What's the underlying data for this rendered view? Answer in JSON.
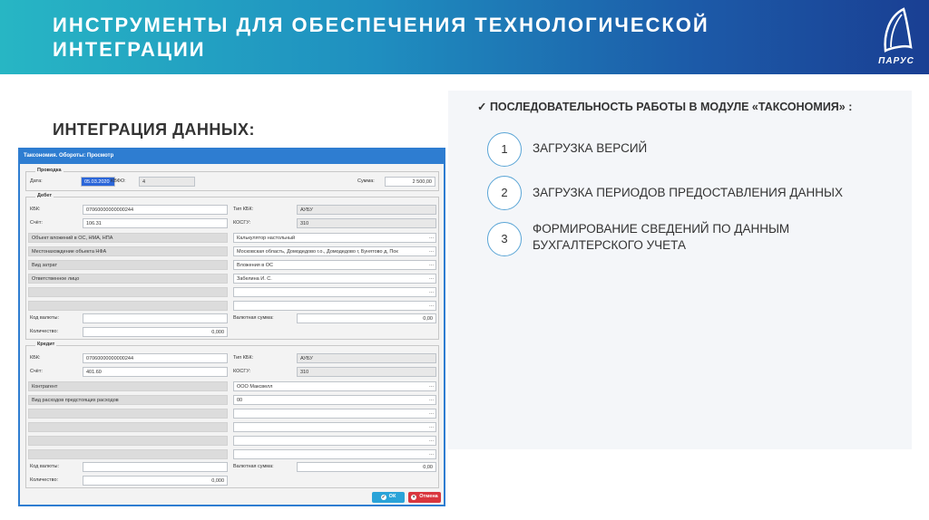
{
  "header": {
    "title_line1": "ИНСТРУМЕНТЫ ДЛЯ ОБЕСПЕЧЕНИЯ ТЕХНОЛОГИЧЕСКОЙ",
    "title_line2": "ИНТЕГРАЦИИ",
    "logo_text": "ПАРУС"
  },
  "section_title": "ИНТЕГРАЦИЯ ДАННЫХ:",
  "dialog": {
    "title": "Таксономия. Обороты: Просмотр",
    "posting": {
      "label": "Проводка",
      "date_label": "Дата:",
      "date_value": "05.03.2020",
      "kvfo_label": "КВФО:",
      "kvfo_value": "4",
      "sum_label": "Сумма:",
      "sum_value": "2 500,00"
    },
    "debit": {
      "label": "Дебет",
      "kbk_label": "КБК:",
      "kbk_value": "07060000000000244",
      "kbk_type_label": "Тип КБК:",
      "kbk_type_value": "АУБУ",
      "account_label": "Счёт:",
      "account_value": "106.31",
      "kosgu_label": "КОСГУ:",
      "kosgu_value": "310",
      "analytics": [
        {
          "name": "Объект вложений в ОС, НМА, НПА",
          "value": "Калькулятор настольный"
        },
        {
          "name": "Местонахождение объекта НФА",
          "value": "Московская область, Домодедово г.о., Домодедово г, Бунятово д, Пок"
        },
        {
          "name": "Вид затрат",
          "value": "Вложения в ОС"
        },
        {
          "name": "Ответственное лицо",
          "value": "Забелина И. С."
        },
        {
          "name": "",
          "value": ""
        },
        {
          "name": "",
          "value": ""
        }
      ],
      "currency_label": "Код валюты:",
      "currency_value": "",
      "currency_sum_label": "Валютная сумма:",
      "currency_sum_value": "0,00",
      "qty_label": "Количество:",
      "qty_value": "0,000"
    },
    "credit": {
      "label": "Кредит",
      "kbk_label": "КБК:",
      "kbk_value": "07060000000000244",
      "kbk_type_label": "Тип КБК:",
      "kbk_type_value": "АУБУ",
      "account_label": "Счёт:",
      "account_value": "401.60",
      "kosgu_label": "КОСГУ:",
      "kosgu_value": "310",
      "analytics": [
        {
          "name": "Контрагент",
          "value": "ООО Максвелл"
        },
        {
          "name": "Вид расходов предстоящих расходов",
          "value": "00"
        },
        {
          "name": "",
          "value": ""
        },
        {
          "name": "",
          "value": ""
        },
        {
          "name": "",
          "value": ""
        },
        {
          "name": "",
          "value": ""
        }
      ],
      "currency_label": "Код валюты:",
      "currency_value": "",
      "currency_sum_label": "Валютная сумма:",
      "currency_sum_value": "0,00",
      "qty_label": "Количество:",
      "qty_value": "0,000"
    },
    "ok_label": "ОК",
    "cancel_label": "Отмена"
  },
  "right_panel": {
    "heading": "✓ ПОСЛЕДОВАТЕЛЬНОСТЬ РАБОТЫ В МОДУЛЕ «ТАКСОНОМИЯ» :",
    "steps": [
      {
        "num": "1",
        "line1": "ЗАГРУЗКА ВЕРСИЙ",
        "line2": ""
      },
      {
        "num": "2",
        "line1": "ЗАГРУЗКА ПЕРИОДОВ ПРЕДОСТАВЛЕНИЯ ДАННЫХ",
        "line2": ""
      },
      {
        "num": "3",
        "line1": "ФОРМИРОВАНИЕ СВЕДЕНИЙ ПО ДАННЫМ",
        "line2": "БУХГАЛТЕРСКОГО УЧЕТА"
      }
    ]
  },
  "colors": {
    "banner_start": "#27b6c4",
    "banner_end": "#1a3f93",
    "dialog_accent": "#2e7dd1",
    "ok_button": "#2aa3d8",
    "cancel_button": "#d9363e"
  },
  "icons": [
    "parus-logo-icon",
    "ellipsis-icon",
    "ok-icon",
    "cancel-icon",
    "checkmark-icon"
  ]
}
